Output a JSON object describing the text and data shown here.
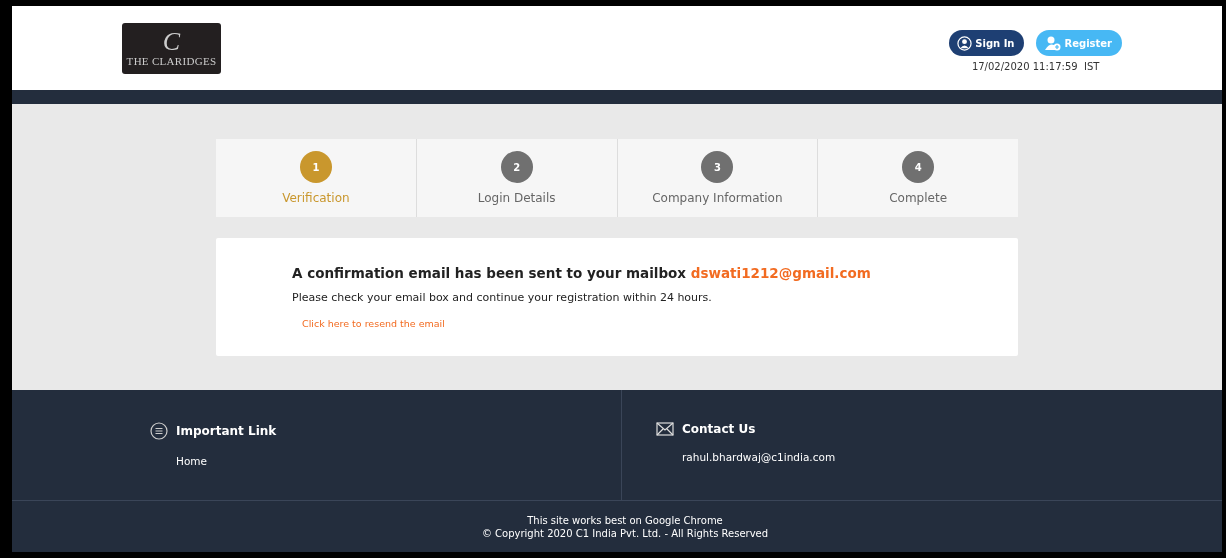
{
  "header": {
    "logo": {
      "monogram": "C",
      "name": "THE CLARIDGES"
    },
    "buttons": [
      {
        "kind": "signin",
        "label": "Sign In"
      },
      {
        "kind": "register",
        "label": "Register"
      }
    ],
    "datetime": "17/02/2020 11:17:59  IST"
  },
  "steps": [
    {
      "number": "1",
      "label": "Verification",
      "selected": true
    },
    {
      "number": "2",
      "label": "Login Details",
      "selected": false
    },
    {
      "number": "3",
      "label": "Company Information",
      "selected": false
    },
    {
      "number": "4",
      "label": "Complete",
      "selected": false
    }
  ],
  "message": {
    "heading": "A confirmation email has been sent to your mailbox **dswati1212@gmail.com**",
    "body": "Please check your email box and continue your registration within 24 hours.",
    "link": "Click here to resend the email"
  },
  "footer": {
    "sections": [
      {
        "kind": "links",
        "title": "Important Link",
        "items": [
          "Home"
        ]
      },
      {
        "kind": "contact",
        "title": "Contact Us",
        "items": [
          "rahul.bhardwaj@c1india.com"
        ]
      }
    ],
    "notes": [
      "This site works best on Google Chrome",
      "© Copyright 2020 C1 India Pvt. Ltd. - All Rights Reserved"
    ]
  }
}
